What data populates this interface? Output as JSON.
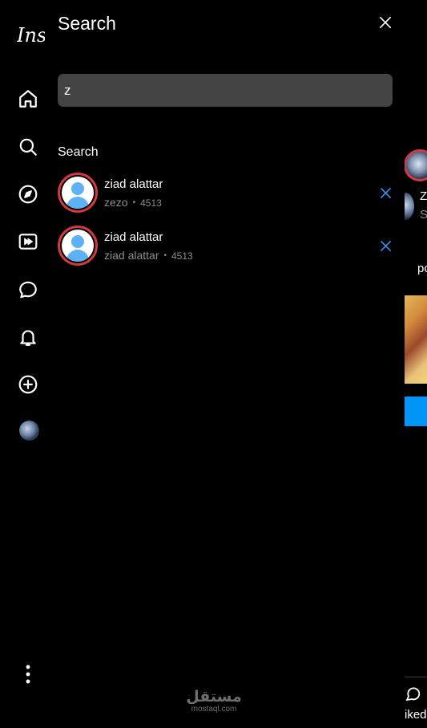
{
  "app": {
    "logo_text": "Instagram"
  },
  "rail": {
    "items": [
      {
        "icon": "home-icon"
      },
      {
        "icon": "search-icon"
      },
      {
        "icon": "explore-icon"
      },
      {
        "icon": "reels-icon"
      },
      {
        "icon": "messages-icon"
      },
      {
        "icon": "notifications-icon"
      },
      {
        "icon": "create-icon"
      },
      {
        "icon": "profile-avatar"
      }
    ],
    "more_icon": "more-icon"
  },
  "search_panel": {
    "title": "Search",
    "input_value": "z",
    "input_placeholder": "",
    "section_label": "Search",
    "results": [
      {
        "name": "ziad alattar",
        "username": "zezo",
        "count": "4513"
      },
      {
        "name": "ziad alattar",
        "username": "ziad alattar",
        "count": "4513"
      }
    ]
  },
  "feed": {
    "suggestion_name": "Z",
    "suggestion_sub": "S",
    "post_user": "po",
    "likes_text": "iked"
  },
  "watermark": {
    "arabic": "مستقل",
    "latin": "mostaql.com"
  },
  "colors": {
    "background": "#000000",
    "search_box": "#434343",
    "story_ring": "#d23a3f",
    "avatar_silhouette": "#5fb1f5",
    "remove_icon": "#2e8ef0",
    "muted_text": "#8e8e8e",
    "accent": "#0095f6"
  }
}
